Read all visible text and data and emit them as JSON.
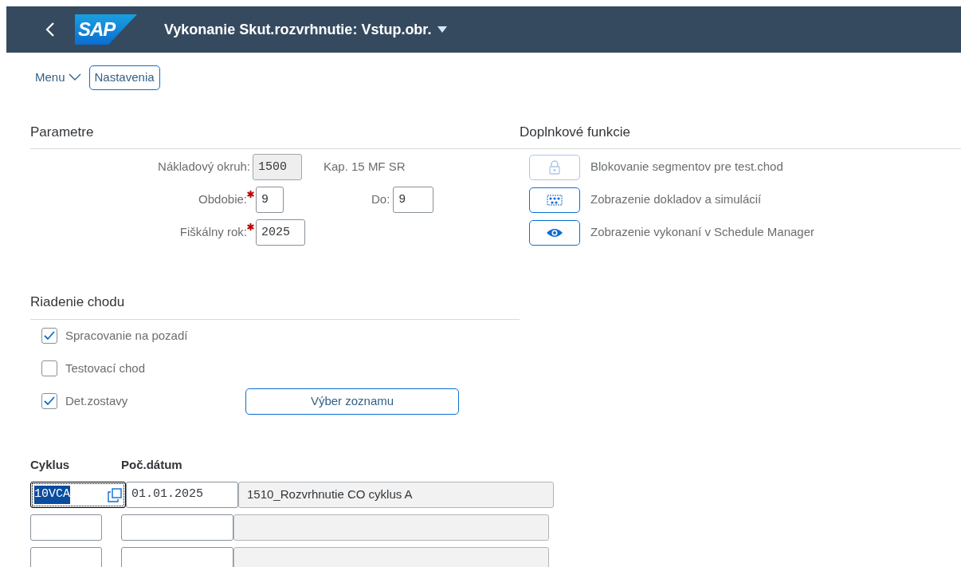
{
  "shell": {
    "title": "Vykonanie Skut.rozvrhnutie: Vstup.obr.",
    "logo": "SAP"
  },
  "toolbar": {
    "menu": "Menu",
    "buttons": [
      "Nastavenia"
    ]
  },
  "parameters": {
    "title": "Parametre",
    "fields": [
      {
        "label": "Nákladový okruh:",
        "value": "1500",
        "required": false,
        "readonly": true,
        "note": "Kap. 15 MF SR"
      },
      {
        "label": "Obdobie:",
        "value": "9",
        "required": true,
        "readonly": false,
        "to_label": "Do:",
        "to_value": "9"
      },
      {
        "label": "Fiškálny rok:",
        "value": "2025",
        "required": true,
        "readonly": false
      }
    ]
  },
  "extra_functions": {
    "title": "Doplnkové funkcie",
    "items": [
      {
        "kind": "lock",
        "label": "Blokovanie segmentov pre test.chod",
        "disabled": true
      },
      {
        "kind": "abacus",
        "label": "Zobrazenie dokladov a simulácií",
        "disabled": false
      },
      {
        "kind": "eye",
        "label": "Zobrazenie vykonaní v Schedule Manager",
        "disabled": false
      }
    ]
  },
  "run_control": {
    "title": "Riadenie chodu",
    "options": [
      {
        "label": "Spracovanie na pozadí",
        "checked": true
      },
      {
        "label": "Testovací chod",
        "checked": false
      },
      {
        "label": "Det.zostavy",
        "checked": true,
        "button": "Výber zoznamu"
      }
    ]
  },
  "cycles": {
    "columns": [
      "Cyklus",
      "Poč.dátum"
    ],
    "rows": [
      {
        "cycle": "10VCA",
        "start_date": "01.01.2025",
        "description": "1510_Rozvrhnutie CO cyklus  A",
        "focused": true
      },
      {
        "focused": false
      },
      {
        "focused": false
      }
    ]
  }
}
